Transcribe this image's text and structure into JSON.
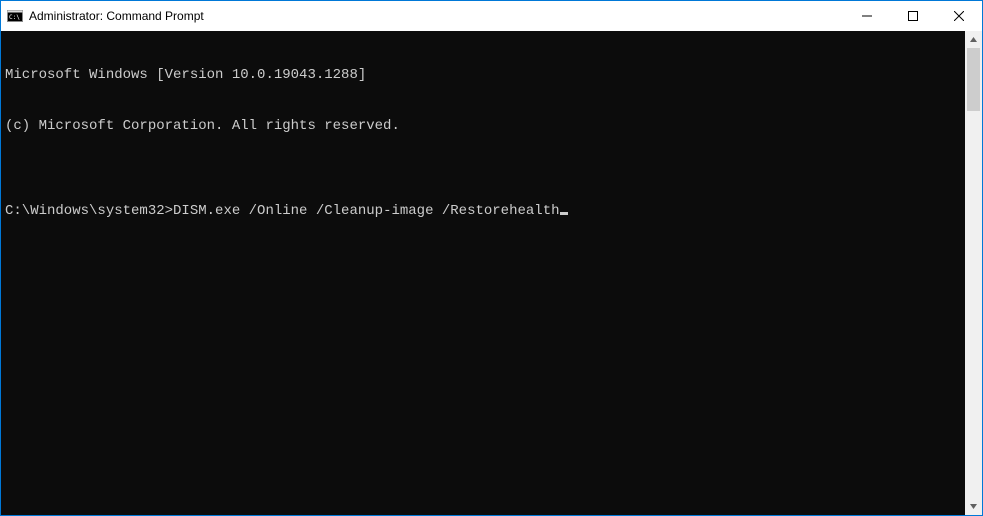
{
  "window": {
    "title": "Administrator: Command Prompt"
  },
  "terminal": {
    "lines": [
      "Microsoft Windows [Version 10.0.19043.1288]",
      "(c) Microsoft Corporation. All rights reserved.",
      ""
    ],
    "prompt": "C:\\Windows\\system32>",
    "command": "DISM.exe /Online /Cleanup-image /Restorehealth"
  },
  "scrollbar": {
    "thumb_top_pct": 0,
    "thumb_height_pct": 14
  }
}
